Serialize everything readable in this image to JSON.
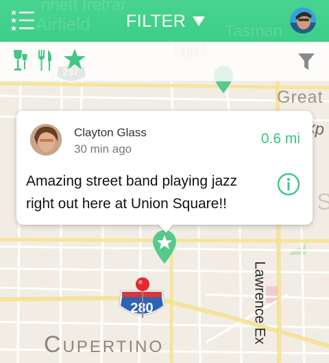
{
  "colors": {
    "accent": "#3fd28b",
    "accent_dark": "#2fbf78",
    "distance": "#37c57c",
    "pin_red": "#e8262e",
    "map_bg": "#f2ede4"
  },
  "header": {
    "title": "FILTER",
    "menu_icon": "list-menu-icon",
    "dropdown_icon": "triangle-down-icon",
    "avatar": "user-profile-avatar"
  },
  "background_map_labels": {
    "header_ghost_1": "nnett Iretrar",
    "header_ghost_2": "Airfield",
    "header_ghost_3": "Tasman",
    "highway_101": "101",
    "highway_237": "237",
    "highway_280": "280",
    "great": "Great",
    "xp": "xp",
    "s_ghost": "S",
    "lawrence": "Lawrence Ex",
    "cupertino": "Cupertino"
  },
  "filterbar": {
    "drinks_icon": "wine-glass-icon",
    "food_icon": "fork-knife-icon",
    "favorites_icon": "star-icon",
    "filter_icon": "funnel-icon"
  },
  "callout": {
    "user_name": "Clayton Glass",
    "time_ago": "30 min ago",
    "distance": "0.6 mi",
    "message": "Amazing street band playing jazz right out here at Union Square!!",
    "info_icon": "info-circle-icon"
  },
  "markers": {
    "star_pin": "star-map-pin-icon",
    "food_pin": "food-map-pin-icon",
    "user_location_pin": "red-location-pin-icon"
  }
}
